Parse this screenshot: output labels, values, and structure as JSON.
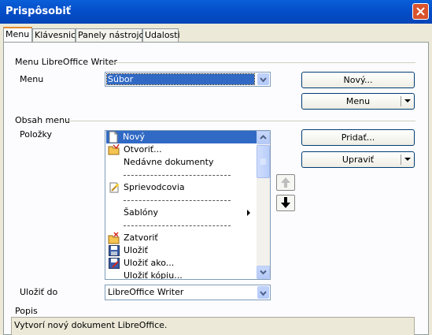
{
  "window": {
    "title": "Prispôsobiť"
  },
  "tabs": [
    {
      "label": "Menu"
    },
    {
      "label": "Klávesnica"
    },
    {
      "label": "Panely nástrojov"
    },
    {
      "label": "Udalosti"
    }
  ],
  "menu_section": {
    "heading": "Menu LibreOffice Writer",
    "menu_label": "Menu",
    "menu_value": "Súbor",
    "new_button": "Nový...",
    "menu_button": "Menu"
  },
  "content_section": {
    "heading": "Obsah menu",
    "items_label": "Položky",
    "add_button": "Pridať...",
    "modify_button": "Upraviť",
    "items": [
      {
        "label": "Nový",
        "icon": "new-document-icon"
      },
      {
        "label": "Otvoriť...",
        "icon": "open-folder-icon"
      },
      {
        "label": "Nedávne dokumenty",
        "icon": ""
      },
      {
        "label": "----------------------------",
        "icon": ""
      },
      {
        "label": "Sprievodcovia",
        "icon": "wizard-icon"
      },
      {
        "label": "----------------------------",
        "icon": ""
      },
      {
        "label": "Šablóny",
        "icon": ""
      },
      {
        "label": "----------------------------",
        "icon": ""
      },
      {
        "label": "Zatvoriť",
        "icon": "close-document-icon"
      },
      {
        "label": "Uložiť",
        "icon": "save-icon"
      },
      {
        "label": "Uložiť ako...",
        "icon": "save-as-icon"
      },
      {
        "label": "Uložiť kópiu...",
        "icon": ""
      }
    ]
  },
  "save_in": {
    "label": "Uložiť do",
    "value": "LibreOffice Writer"
  },
  "description": {
    "label": "Popis",
    "text": "Vytvorí nový dokument LibreOffice."
  },
  "colors": {
    "selection": "#316AC5",
    "titlebar": "#0550CC",
    "dialog_bg": "#ECE9D8"
  }
}
